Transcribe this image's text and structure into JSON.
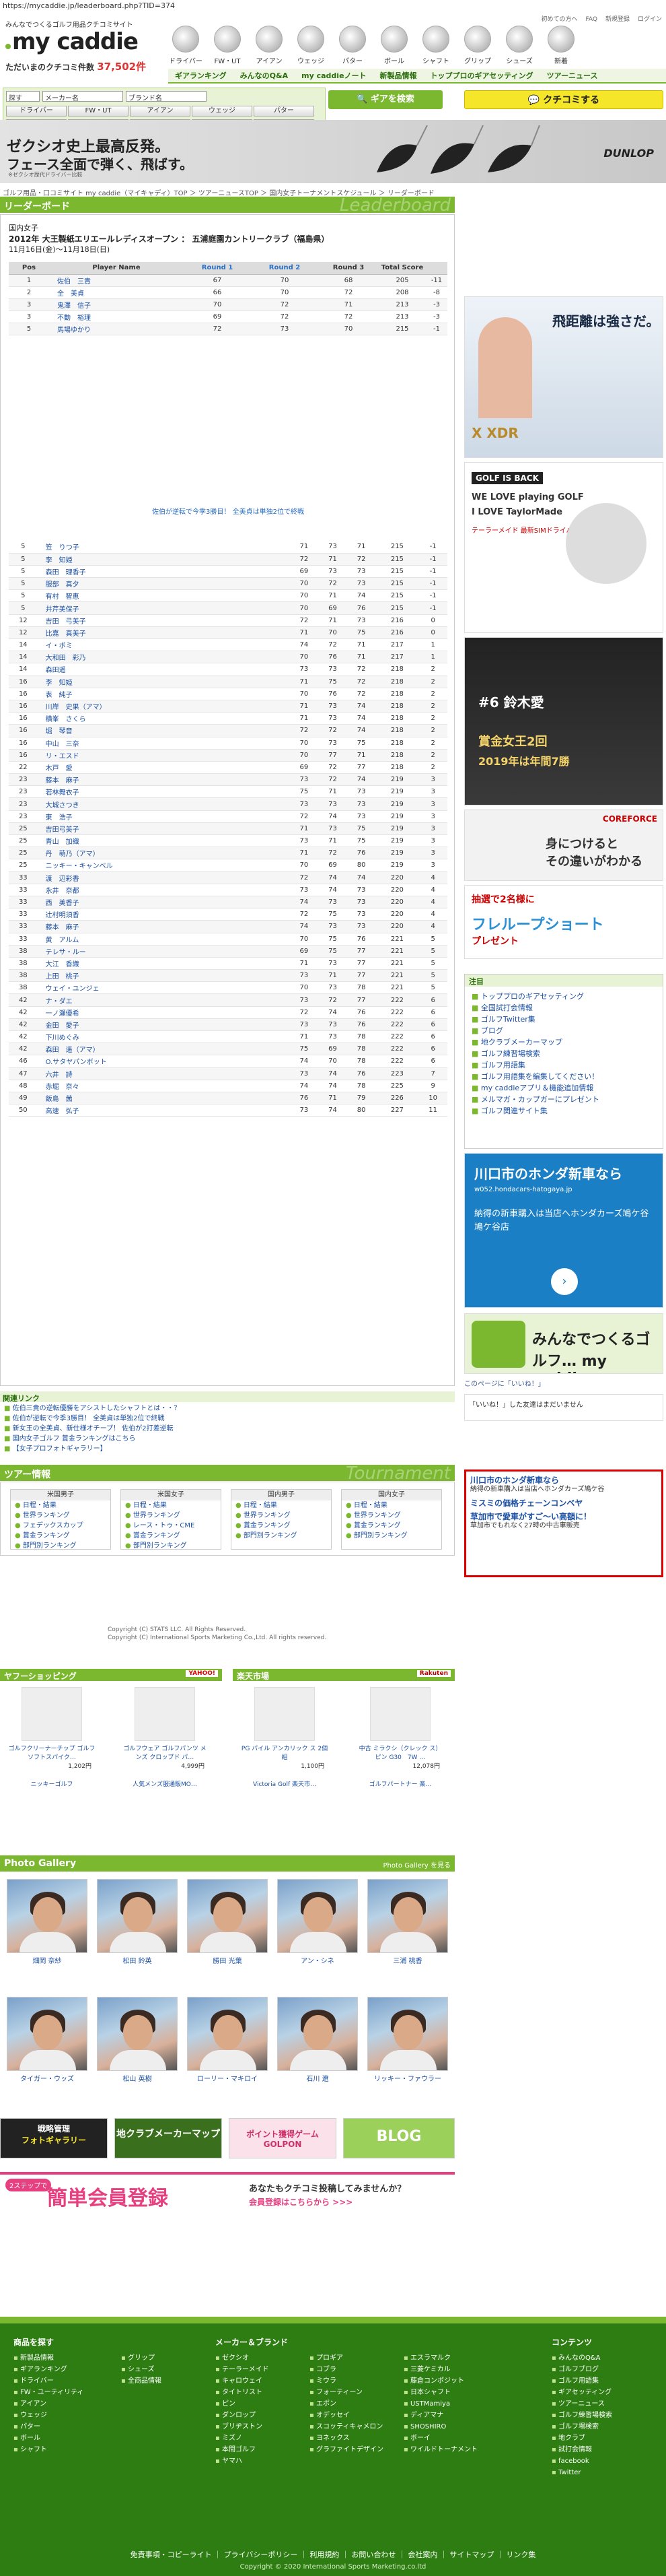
{
  "browser": {
    "url": "https://mycaddie.jp/leaderboard.php?TID=374"
  },
  "header": {
    "tagline": "みんなでつくるゴルフ用品クチコミサイト",
    "logo": "my caddie",
    "reviews_label": "ただいまのクチコミ件数",
    "reviews_count": "37,502件",
    "top_links": [
      "初めての方へ",
      "FAQ",
      "新規登録",
      "ログイン"
    ],
    "categories": [
      "ドライバー",
      "FW・UT",
      "アイアン",
      "ウェッジ",
      "パター",
      "ボール",
      "シャフト",
      "グリップ",
      "シューズ",
      "新着"
    ],
    "nav": [
      "ギアランキング",
      "みんなのQ&A",
      "my caddieノート",
      "新製品情報",
      "トッププロのギアセッティング",
      "ツアーニュース"
    ]
  },
  "search": {
    "selects": [
      "探す",
      "メーカー名",
      "ブランド名"
    ],
    "grid": [
      "ドライバー",
      "FW・UT",
      "アイアン",
      "ウェッジ",
      "パター",
      "ボール",
      "シャフト",
      "グリップ",
      "シューズ",
      "新着計測"
    ],
    "gear_button": "ギアを検索",
    "review_button": "クチコミする"
  },
  "banner": {
    "line1": "ゼクシオ史上最高反発。",
    "line2": "フェース全面で弾く、飛ばす。",
    "brand": "DUNLOP",
    "note": "※ゼクシオ歴代ドライバー比較"
  },
  "breadcrumb": "ゴルフ用品・口コミサイト my caddie（マイキャディ）TOP ＞ ツアーニュースTOP ＞ 国内女子トーナメントスケジュール ＞ リーダーボード",
  "leaderboard": {
    "title": "リーダーボード",
    "title_en": "Leaderboard",
    "tour": "国内女子",
    "tournament": "2012年 大王製紙エリエールレディスオープン ： 五浦庭園カントリークラブ（福島県）",
    "dates": "11月16日(金)〜11月18日(日)",
    "columns": [
      "Pos",
      "Player Name",
      "Round 1",
      "Round 2",
      "Round 3",
      "Total Score",
      ""
    ],
    "top": [
      [
        "1",
        "佐伯　三貴",
        "67",
        "70",
        "68",
        "205",
        "-11"
      ],
      [
        "2",
        "全　美貞",
        "66",
        "70",
        "72",
        "208",
        "-8"
      ],
      [
        "3",
        "鬼澤　信子",
        "70",
        "72",
        "71",
        "213",
        "-3"
      ],
      [
        "3",
        "不動　裕理",
        "69",
        "72",
        "72",
        "213",
        "-3"
      ],
      [
        "5",
        "馬場ゆかり",
        "72",
        "73",
        "70",
        "215",
        "-1"
      ]
    ],
    "notice": "佐伯が逆転で今季3勝目！ 全美貞は単独2位で終戦",
    "rest": [
      [
        "5",
        "笠　りつ子",
        "71",
        "73",
        "71",
        "215",
        "-1"
      ],
      [
        "5",
        "李　知姫",
        "72",
        "71",
        "72",
        "215",
        "-1"
      ],
      [
        "5",
        "森田　理香子",
        "69",
        "73",
        "73",
        "215",
        "-1"
      ],
      [
        "5",
        "服部　真夕",
        "70",
        "72",
        "73",
        "215",
        "-1"
      ],
      [
        "5",
        "有村　智恵",
        "70",
        "71",
        "74",
        "215",
        "-1"
      ],
      [
        "5",
        "井芹美保子",
        "70",
        "69",
        "76",
        "215",
        "-1"
      ],
      [
        "12",
        "吉田　弓美子",
        "72",
        "71",
        "73",
        "216",
        "0"
      ],
      [
        "12",
        "比嘉　真美子",
        "71",
        "70",
        "75",
        "216",
        "0"
      ],
      [
        "14",
        "イ・ボミ",
        "74",
        "72",
        "71",
        "217",
        "1"
      ],
      [
        "14",
        "大和田　彩乃",
        "70",
        "76",
        "71",
        "217",
        "1"
      ],
      [
        "14",
        "森田遥",
        "73",
        "73",
        "72",
        "218",
        "2"
      ],
      [
        "16",
        "李　知姫",
        "71",
        "75",
        "72",
        "218",
        "2"
      ],
      [
        "16",
        "表　純子",
        "70",
        "76",
        "72",
        "218",
        "2"
      ],
      [
        "16",
        "川岸　史果（アマ）",
        "71",
        "73",
        "74",
        "218",
        "2"
      ],
      [
        "16",
        "横峯　さくら",
        "71",
        "73",
        "74",
        "218",
        "2"
      ],
      [
        "16",
        "堀　琴音",
        "72",
        "72",
        "74",
        "218",
        "2"
      ],
      [
        "16",
        "中山　三奈",
        "70",
        "73",
        "75",
        "218",
        "2"
      ],
      [
        "16",
        "リ・エスド",
        "70",
        "77",
        "71",
        "218",
        "2"
      ],
      [
        "22",
        "木戸　愛",
        "69",
        "72",
        "77",
        "218",
        "2"
      ],
      [
        "23",
        "藤本　麻子",
        "73",
        "72",
        "74",
        "219",
        "3"
      ],
      [
        "23",
        "若林舞衣子",
        "75",
        "71",
        "73",
        "219",
        "3"
      ],
      [
        "23",
        "大城さつき",
        "73",
        "73",
        "73",
        "219",
        "3"
      ],
      [
        "23",
        "東　浩子",
        "72",
        "74",
        "73",
        "219",
        "3"
      ],
      [
        "25",
        "吉田弓美子",
        "71",
        "73",
        "75",
        "219",
        "3"
      ],
      [
        "25",
        "青山　加織",
        "73",
        "71",
        "75",
        "219",
        "3"
      ],
      [
        "25",
        "丹　萌乃（アマ）",
        "71",
        "72",
        "76",
        "219",
        "3"
      ],
      [
        "25",
        "ニッキー・キャンベル",
        "70",
        "69",
        "80",
        "219",
        "3"
      ],
      [
        "33",
        "渡　辺彩香",
        "72",
        "74",
        "74",
        "220",
        "4"
      ],
      [
        "33",
        "永井　奈都",
        "73",
        "74",
        "73",
        "220",
        "4"
      ],
      [
        "33",
        "西　美香子",
        "74",
        "73",
        "73",
        "220",
        "4"
      ],
      [
        "33",
        "辻村明須香",
        "72",
        "75",
        "73",
        "220",
        "4"
      ],
      [
        "33",
        "藤本　麻子",
        "74",
        "73",
        "73",
        "220",
        "4"
      ],
      [
        "33",
        "黄　アルム",
        "70",
        "75",
        "76",
        "221",
        "5"
      ],
      [
        "38",
        "テレサ・ルー",
        "69",
        "75",
        "77",
        "221",
        "5"
      ],
      [
        "38",
        "大江　香織",
        "71",
        "73",
        "77",
        "221",
        "5"
      ],
      [
        "38",
        "上田　桃子",
        "73",
        "71",
        "77",
        "221",
        "5"
      ],
      [
        "38",
        "ウェイ・ユンジェ",
        "70",
        "73",
        "78",
        "221",
        "5"
      ],
      [
        "42",
        "ナ・ダエ",
        "73",
        "72",
        "77",
        "222",
        "6"
      ],
      [
        "42",
        "一ノ瀬優希",
        "72",
        "74",
        "76",
        "222",
        "6"
      ],
      [
        "42",
        "金田　愛子",
        "73",
        "73",
        "76",
        "222",
        "6"
      ],
      [
        "42",
        "下川めぐみ",
        "71",
        "73",
        "78",
        "222",
        "6"
      ],
      [
        "42",
        "森田　遥（アマ）",
        "75",
        "69",
        "78",
        "222",
        "6"
      ],
      [
        "46",
        "O.サタヤパンボット",
        "74",
        "70",
        "78",
        "222",
        "6"
      ],
      [
        "47",
        "六井　詩",
        "73",
        "74",
        "76",
        "223",
        "7"
      ],
      [
        "48",
        "赤堀　奈々",
        "74",
        "74",
        "78",
        "225",
        "9"
      ],
      [
        "49",
        "飯島　茜",
        "76",
        "71",
        "79",
        "226",
        "10"
      ],
      [
        "50",
        "高速　弘子",
        "73",
        "74",
        "80",
        "227",
        "11"
      ]
    ]
  },
  "related": {
    "title": "関連リンク",
    "links": [
      "佐伯三貴の逆転優勝をアシストしたシャフトとは・・？",
      "佐伯が逆転で今季3勝目！ 全美貞は単独2位で終戦",
      "新女王の全美貞、新仕様オチープ！ 佐伯が2打差逆転",
      "国内女子ゴルフ 賞金ランキングはこちら",
      "【女子プロフォトギャラリー】"
    ]
  },
  "tour": {
    "title": "ツアー情報",
    "title_en": "Tournament",
    "cols": [
      {
        "head": "米国男子",
        "items": [
          "日程・結果",
          "世界ランキング",
          "フェデックスカップ",
          "賞金ランキング",
          "部門別ランキング"
        ]
      },
      {
        "head": "米国女子",
        "items": [
          "日程・結果",
          "世界ランキング",
          "レース・トゥ・CME",
          "賞金ランキング",
          "部門別ランキング"
        ]
      },
      {
        "head": "国内男子",
        "items": [
          "日程・結果",
          "世界ランキング",
          "賞金ランキング",
          "部門別ランキング"
        ]
      },
      {
        "head": "国内女子",
        "items": [
          "日程・結果",
          "世界ランキング",
          "賞金ランキング",
          "部門別ランキング"
        ]
      }
    ],
    "copyright1": "Copyright (C) STATS LLC. All Rights Reserved.",
    "copyright2": "Copyright (C) International Sports Marketing Co.,Ltd. All rights reserved."
  },
  "shopping": {
    "yahoo": "ヤフーショッピング",
    "rakuten": "楽天市場",
    "items": [
      {
        "name": "ゴルフクリーナーチップ ゴルフ ソフトスパイク…",
        "price": "1,202円",
        "shop": "ニッキーゴルフ"
      },
      {
        "name": "ゴルフウェア ゴルフパンツ メンズ クロップド パ…",
        "price": "4,999円",
        "shop": "人気メンズ服通販MO…"
      },
      {
        "name": "PG パイル アンカリック ス 2個組",
        "price": "1,100円",
        "shop": "Victoria Golf 楽天市…"
      },
      {
        "name": "中古 ミラクシ（クレック ス）ピン G30　7W …",
        "price": "12,078円",
        "shop": "ゴルフパートナー 楽…"
      }
    ]
  },
  "gallery": {
    "title": "Photo Gallery",
    "more": "Photo Gallery を見る",
    "row1": [
      "畑岡 奈紗",
      "松田 鈴英",
      "勝田 光葉",
      "アン・シネ",
      "三浦 桃香"
    ],
    "row2": [
      "タイガー・ウッズ",
      "松山 英樹",
      "ローリー・マキロイ",
      "石川 遼",
      "リッキー・ファウラー"
    ]
  },
  "promos": {
    "p1a": "戦略管理",
    "p1b": "フォトギャラリー",
    "p2": "地クラブメーカーマップ",
    "p3": "ポイント獲得ゲーム GOLPON",
    "p4": "BLOG",
    "signup": "簡単会員登録",
    "signup_small": "2ステップで",
    "signup_right": "あなたもクチコミ投稿してみませんか？",
    "signup_right2": "会員登録はこちらから >>>"
  },
  "sidebar": {
    "ad1": {
      "title": "飛距離は強さだ。",
      "brand": "X XDR"
    },
    "ad2": {
      "line1": "GOLF IS BACK",
      "line2": "WE LOVE playing GOLF",
      "line3": "I LOVE TaylorMade",
      "line4": "テーラーメイド 最新SIMドライバー"
    },
    "ad3": {
      "line1": "#6 鈴木愛",
      "line2": "賞金女王2回",
      "line3": "2019年は年間7勝"
    },
    "ad4": {
      "brand": "COREFORCE",
      "line1": "身につけると",
      "line2": "その違いがわかる"
    },
    "ad5": {
      "line1": "抽選で2名様に",
      "line2": "フレループショート",
      "line3": "プレゼント"
    },
    "links_title": "注目",
    "links": [
      "トッププロのギアセッティング",
      "全国試打会情報",
      "ゴルフTwitter集",
      "ブログ",
      "地クラブメーカーマップ",
      "ゴルフ練習場検索",
      "ゴルフ用語集",
      "ゴルフ用語集を編集してください！",
      "my caddieアプリ＆機能追加情報",
      "メルマガ・カップガーにプレゼント",
      "ゴルフ関連サイト集"
    ],
    "ad6": {
      "title": "川口市のホンダ新車なら",
      "url": "w052.hondacars-hatogaya.jp",
      "desc": "納得の新車購入は当店へホンダカーズ鳩ケ谷 鳩ケ谷店"
    },
    "mc_banner": "みんなでつくるゴルフ… my caddie",
    "fb": "このページに「いいね！」",
    "fb_box": "「いいね！」した友達はまだいません",
    "ad7": {
      "t1": "川口市のホンダ新車なら",
      "t2": "納得の新車購入は当店へホンダカーズ鳩ケ谷",
      "t3": "ミスミの価格チェーンコンベヤ",
      "t4": "草加市で愛車がすご〜い高額に！",
      "t5": "草加市でもれなく27時の中古車販売"
    }
  },
  "footer": {
    "cols": [
      {
        "head": "商品を探す",
        "items": [
          "新製品情報",
          "ギアランキング",
          "ドライバー",
          "FW・ユーティリティ",
          "アイアン",
          "ウェッジ",
          "パター",
          "ボール",
          "シャフト"
        ]
      },
      {
        "head": "",
        "items": [
          "グリップ",
          "シューズ",
          "全商品情報"
        ]
      },
      {
        "head": "メーカー＆ブランド",
        "items": [
          "ゼクシオ",
          "テーラーメイド",
          "キャロウェイ",
          "タイトリスト",
          "ピン",
          "ダンロップ",
          "ブリヂストン",
          "ミズノ",
          "本間ゴルフ",
          "ヤマハ"
        ]
      },
      {
        "head": "",
        "items": [
          "プロギア",
          "コブラ",
          "ミウラ",
          "フォーティーン",
          "エポン",
          "オデッセイ",
          "スコッティキャメロン",
          "ヨネックス",
          "グラファイトデザイン"
        ]
      },
      {
        "head": "",
        "items": [
          "エスラマルク",
          "三菱ケミカル",
          "藤倉コンポジット",
          "日本シャフト",
          "USTMamiya",
          "ディアマナ",
          "SHOSHIRO",
          "ボーイ",
          "ワイルドトーナメント"
        ]
      },
      {
        "head": "コンテンツ",
        "items": [
          "みんなのQ&A",
          "ゴルフブログ",
          "ゴルフ用語集",
          "ギアセッティング",
          "ツアーニュース",
          "ゴルフ練習場検索",
          "ゴルフ場検索",
          "地クラブ",
          "試打会情報",
          "facebook",
          "Twitter"
        ]
      }
    ],
    "links": [
      "免責事項・コピーライト",
      "プライバシーポリシー",
      "利用規約",
      "お問い合わせ",
      "会社案内",
      "サイトマップ",
      "リンク集"
    ],
    "copyright": "Copyright © 2020 International Sports Marketing.co.ltd"
  },
  "colors": {
    "brand_green": "#7cb82f",
    "dark_green": "#2d7d12",
    "yellow": "#f5e62a"
  }
}
